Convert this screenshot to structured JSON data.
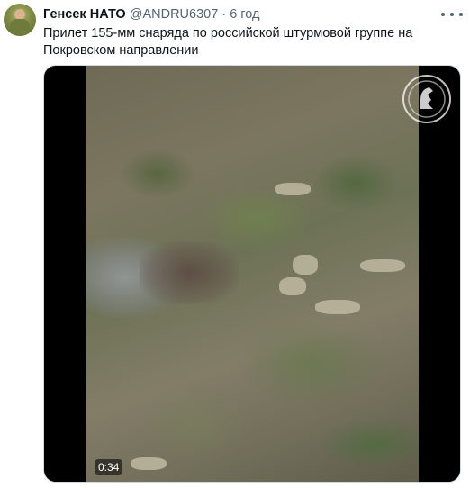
{
  "tweet": {
    "display_name": "Генсек НАТО",
    "handle": "@ANDRU6307",
    "separator": "·",
    "timestamp": "6 год",
    "text": "Прилет 155-мм снаряда по российской штурмовой группе на Покровском направлении"
  },
  "media": {
    "duration": "0:34"
  },
  "icons": {
    "more": "more-horizontal-icon",
    "emblem": "unit-emblem-icon"
  },
  "colors": {
    "text": "#0f1419",
    "secondary": "#536471",
    "media_border": "#cfd9de"
  }
}
